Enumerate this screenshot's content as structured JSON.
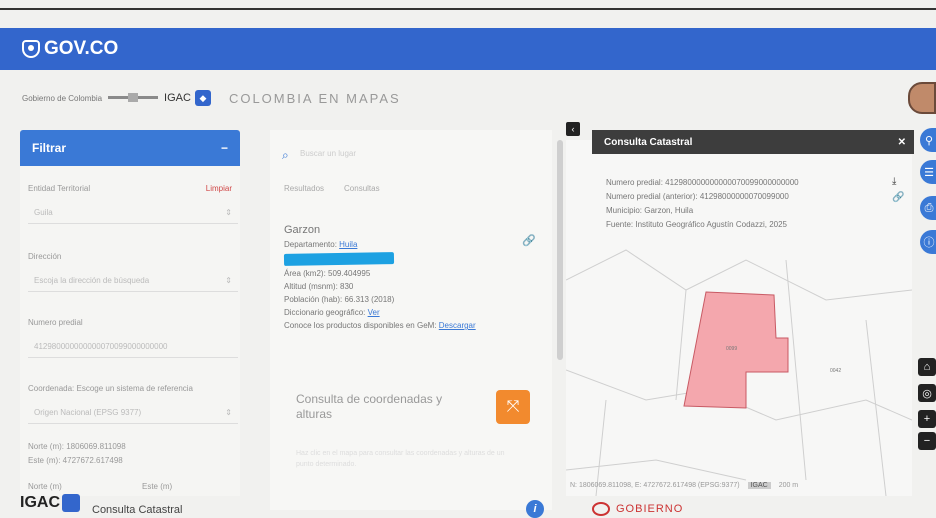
{
  "header": {
    "gov_logo_text": "GOV.CO"
  },
  "brand": {
    "gobierno_small": "Gobierno de Colombia",
    "igac": "IGAC",
    "title": "COLOMBIA EN MAPAS"
  },
  "filter": {
    "title": "Filtrar",
    "collapse_icon": "minus-icon",
    "entidad_label": "Entidad Territorial",
    "limpiar": "Limpiar",
    "entidad_value": "Guila",
    "direccion_label": "Dirección",
    "direccion_placeholder": "Escoja la dirección de búsqueda",
    "numero_predial_label": "Numero predial",
    "numero_predial_value": "412980000000000070099000000000",
    "coordenada_label": "Coordenada: Escoge un sistema de referencia",
    "coordenada_value": "Origen Nacional (EPSG 9377)",
    "norte_text": "Norte (m): 1806069.811098",
    "este_text": "Este (m): 4727672.617498",
    "norte_label": "Norte (m)",
    "este_label": "Este (m)"
  },
  "middle": {
    "search_placeholder": "Buscar un lugar",
    "tab_resultados": "Resultados",
    "tab_consultas": "Consultas",
    "place": {
      "name": "Garzon",
      "departamento_label": "Departamento:",
      "departamento_link": "Huila",
      "area": "Área (km2): 509.404995",
      "altitud": "Altitud (msnm): 830",
      "poblacion": "Población (hab): 66.313 (2018)",
      "diccionario_label": "Diccionario geográfico:",
      "diccionario_link": "Ver",
      "productos_label": "Conoce los productos disponibles en GeM:",
      "productos_link": "Descargar"
    },
    "coord_title": "Consulta de coordenadas y alturas",
    "coord_icon": "crosshair-icon",
    "faint_text": "Haz clic en el mapa para consultar las coordenadas y alturas de un punto determinado."
  },
  "consulta": {
    "title": "Consulta Catastral",
    "close_icon": "close-icon",
    "numero_predial": "Numero predial: 412980000000000070099000000000",
    "numero_predial_anterior": "Numero predial (anterior): 41298000000070099000",
    "municipio": "Municipio: Garzon, Huila",
    "fuente": "Fuente: Instituto Geográfico Agustín Codazzi, 2025"
  },
  "map": {
    "parcel_label": "0099",
    "neighbor_label": "0042",
    "coord_readout": "N: 1806069.811098, E: 4727672.617498 (EPSG:9377)",
    "attrib": "IGAC",
    "scale": "200 m"
  },
  "footer": {
    "igac": "IGAC",
    "consulta_catastral": "Consulta Catastral",
    "info_icon": "info-icon",
    "gobierno": "GOBIERNO"
  },
  "colors": {
    "gov_blue": "#3366cc",
    "panel_blue": "#3a79d6",
    "parcel_fill": "#f4a7ad",
    "orange": "#f28a2e"
  }
}
